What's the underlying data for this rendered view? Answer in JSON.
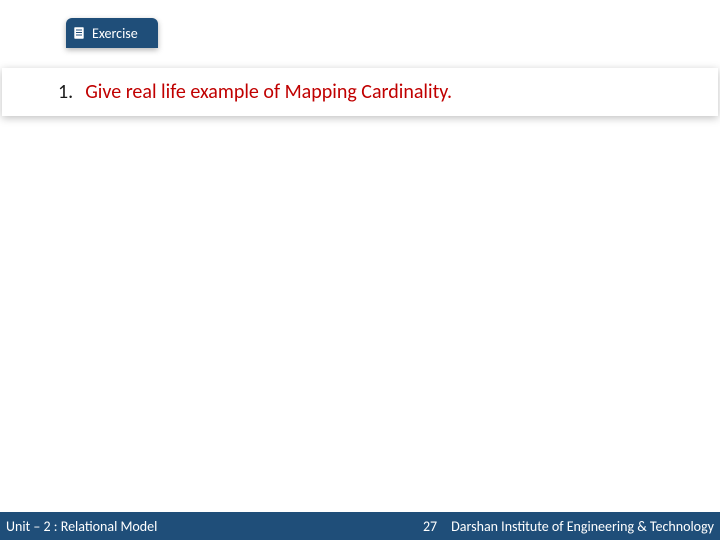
{
  "tab": {
    "label": "Exercise",
    "icon_name": "document-list-icon"
  },
  "question": {
    "number": "1.",
    "text": "Give real life example of Mapping Cardinality."
  },
  "footer": {
    "unit": "Unit – 2 : Relational Model",
    "page": "27",
    "institute": "Darshan Institute of Engineering & Technology"
  }
}
